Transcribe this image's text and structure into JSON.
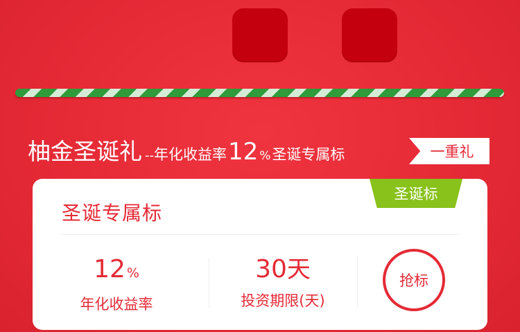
{
  "colors": {
    "background": "#e52a36",
    "tile": "#c4000f",
    "accent_red": "#e52a36",
    "badge_green": "#88c21a",
    "stripe_green": "#2f9b3a",
    "card": "#ffffff"
  },
  "promo": {
    "title": "柚金圣诞礼",
    "dash": "--",
    "subtitle_prefix": "年化收益率",
    "rate": "12",
    "rate_unit": "%",
    "subtitle_suffix": "圣诞专属标"
  },
  "tag": {
    "label": "一重礼"
  },
  "product": {
    "badge": "圣诞标",
    "title": "圣诞专属标",
    "rate_value": "12",
    "rate_unit": "%",
    "rate_label": "年化收益率",
    "term_value": "30",
    "term_unit": "天",
    "term_label": "投资期限(天)",
    "action_label": "抢标"
  }
}
